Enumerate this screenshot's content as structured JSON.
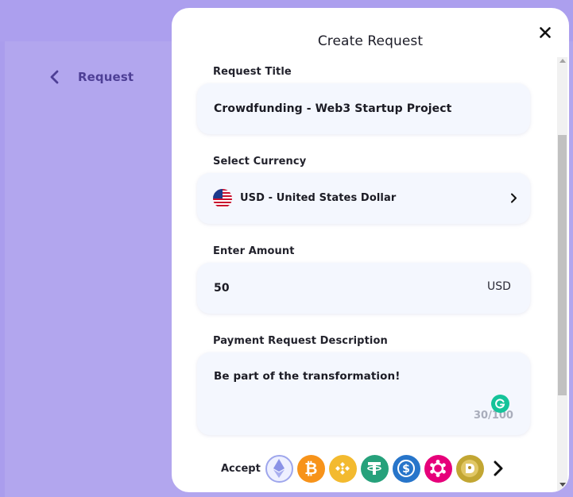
{
  "background": {
    "color": "#b2a6ee"
  },
  "nav": {
    "back_label": "Request"
  },
  "modal": {
    "title": "Create Request",
    "fields": {
      "title": {
        "label": "Request Title",
        "value": "Crowdfunding - Web3 Startup Project"
      },
      "currency": {
        "label": "Select Currency",
        "value": "USD - United States Dollar",
        "flag": "us-flag-icon"
      },
      "amount": {
        "label": "Enter Amount",
        "value": "50",
        "unit": "USD"
      },
      "description": {
        "label": "Payment Request Description",
        "value": "Be part of the transformation!",
        "counter": "30/100"
      }
    },
    "accept": {
      "label": "Accept",
      "coins": [
        {
          "name": "ethereum-icon",
          "color": "#8a92e6"
        },
        {
          "name": "bitcoin-icon",
          "color": "#f7931a"
        },
        {
          "name": "binance-icon",
          "color": "#f3ba2f"
        },
        {
          "name": "tether-icon",
          "color": "#26a17b"
        },
        {
          "name": "usd-coin-icon",
          "color": "#2775ca"
        },
        {
          "name": "polkadot-icon",
          "color": "#e6007a"
        },
        {
          "name": "dogecoin-icon",
          "color": "#c2a633"
        }
      ]
    }
  },
  "colors": {
    "accent_text": "#4e3f96",
    "field_bg": "#f4f7fe",
    "grammarly": "#15c39a"
  }
}
